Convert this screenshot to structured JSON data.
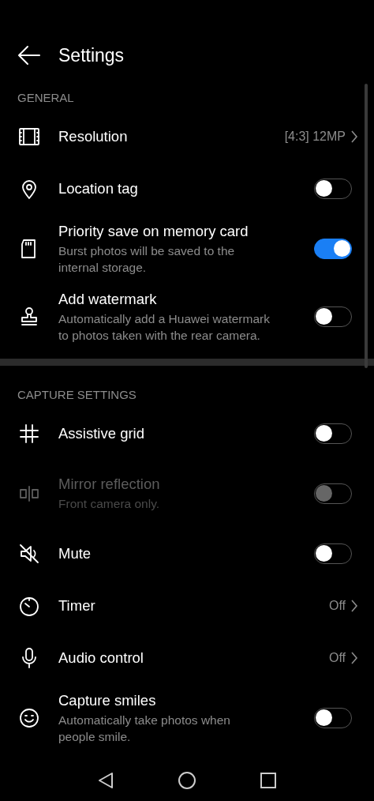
{
  "header": {
    "title": "Settings"
  },
  "sections": [
    {
      "title": "GENERAL",
      "rows": [
        {
          "kind": "value",
          "label": "Resolution",
          "value": "[4:3] 12MP"
        },
        {
          "kind": "toggle",
          "label": "Location tag",
          "on": false,
          "disabled": false
        },
        {
          "kind": "toggle",
          "label": "Priority save on memory card",
          "description": "Burst photos will be saved to the internal storage.",
          "on": true,
          "disabled": false
        },
        {
          "kind": "toggle",
          "label": "Add watermark",
          "description": "Automatically add a Huawei watermark to photos taken with the rear camera.",
          "on": false,
          "disabled": false
        }
      ]
    },
    {
      "title": "CAPTURE SETTINGS",
      "rows": [
        {
          "kind": "toggle",
          "label": "Assistive grid",
          "on": false,
          "disabled": false
        },
        {
          "kind": "toggle",
          "label": "Mirror reflection",
          "description": "Front camera only.",
          "on": false,
          "disabled": true
        },
        {
          "kind": "toggle",
          "label": "Mute",
          "on": false,
          "disabled": false
        },
        {
          "kind": "value",
          "label": "Timer",
          "value": "Off"
        },
        {
          "kind": "value",
          "label": "Audio control",
          "value": "Off"
        },
        {
          "kind": "toggle",
          "label": "Capture smiles",
          "description": "Automatically take photos when people smile.",
          "on": false,
          "disabled": false
        }
      ]
    }
  ]
}
